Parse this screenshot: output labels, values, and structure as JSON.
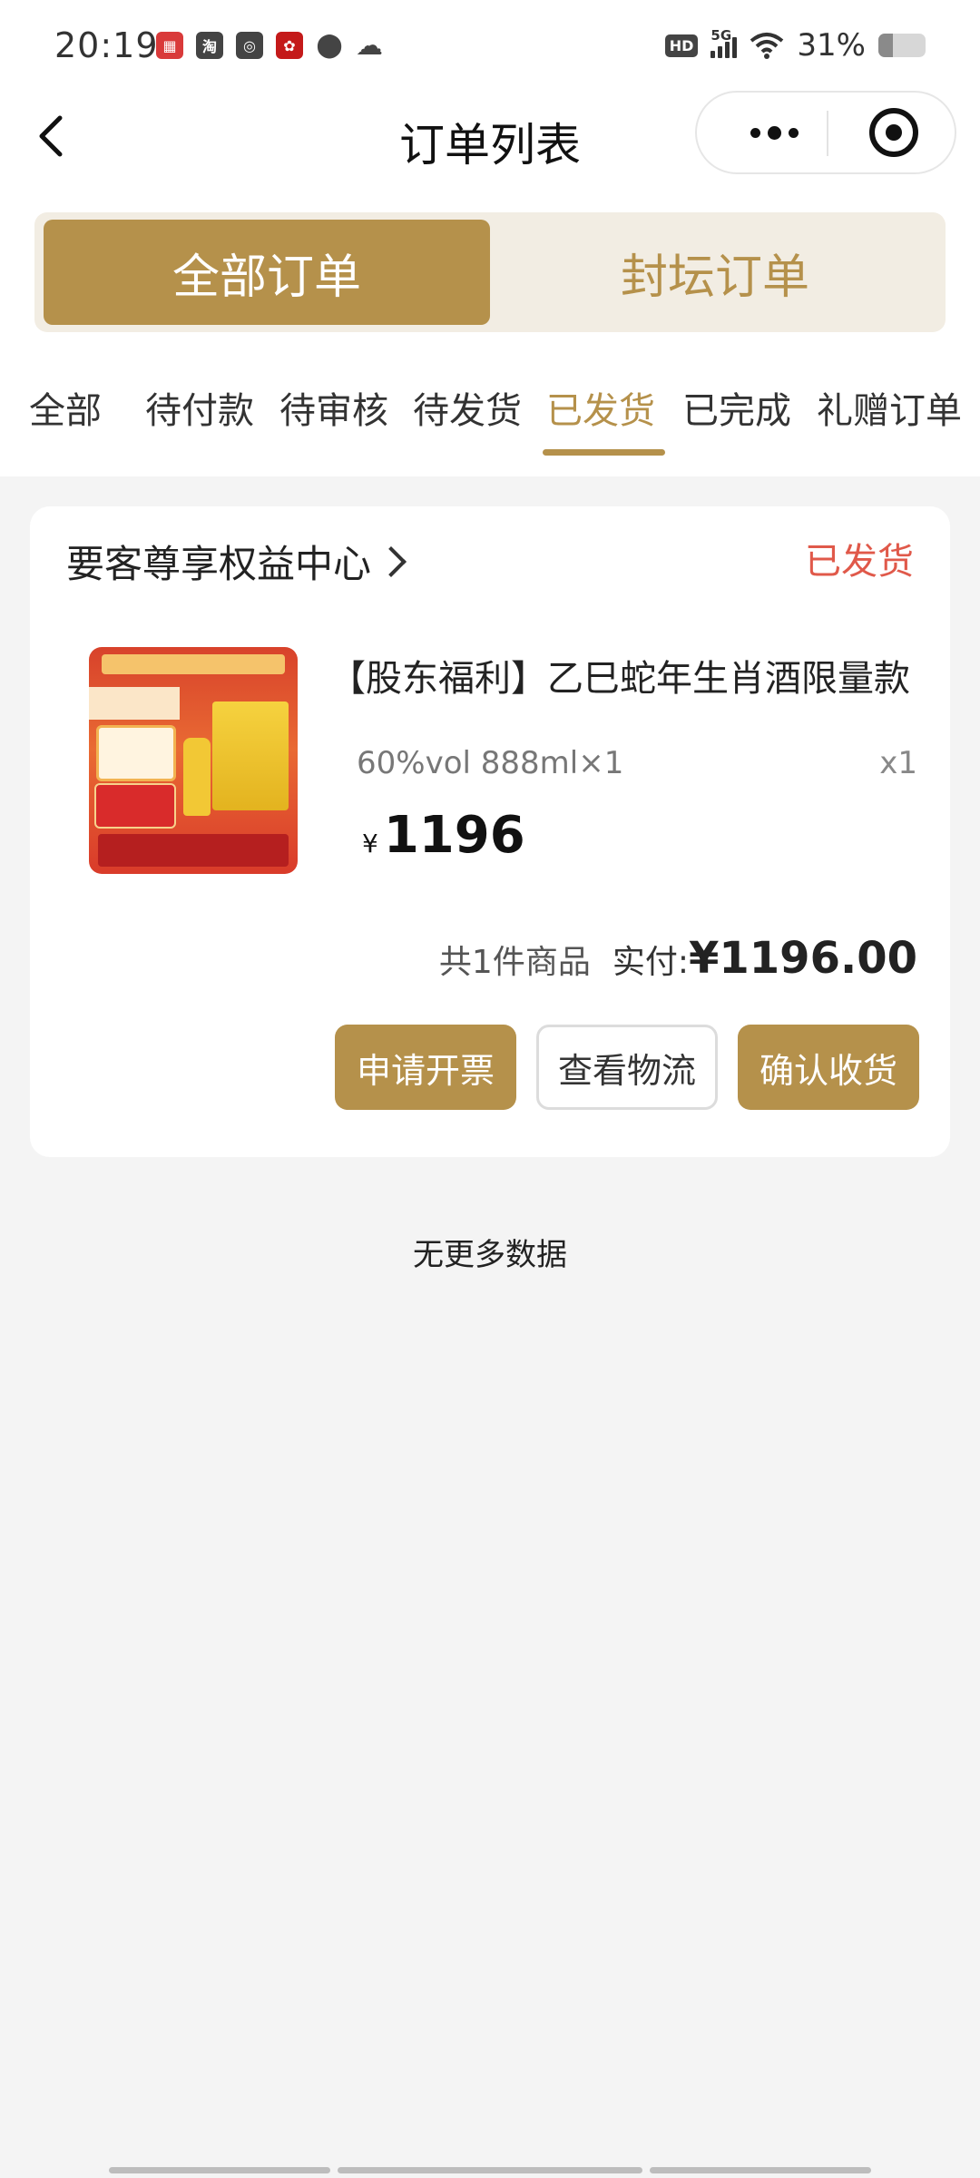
{
  "status_bar": {
    "time": "20:19",
    "network": "5G",
    "battery_percent": "31%",
    "battery_level": 0.31,
    "app_icons": [
      {
        "icon": "calendar-app-icon",
        "color": "#d93a3a"
      },
      {
        "icon": "taobao-app-icon",
        "color": "#444444"
      },
      {
        "icon": "search-app-icon",
        "color": "#444444"
      },
      {
        "icon": "red-app-icon",
        "color": "#c41a1a"
      },
      {
        "icon": "location-icon",
        "color": "#444444"
      },
      {
        "icon": "cloud-icon",
        "color": "#444444"
      }
    ]
  },
  "nav": {
    "title": "订单列表"
  },
  "segment": {
    "active_label": "全部订单",
    "inactive_label": "封坛订单"
  },
  "status_tabs": {
    "items": [
      {
        "label": "全部"
      },
      {
        "label": "待付款"
      },
      {
        "label": "待审核"
      },
      {
        "label": "待发货"
      },
      {
        "label": "已发货"
      },
      {
        "label": "已完成"
      },
      {
        "label": "礼赠订单"
      }
    ],
    "active_index": 4
  },
  "order": {
    "store_name": "要客尊享权益中心",
    "status": "已发货",
    "product": {
      "title": "【股东福利】乙巳蛇年生肖酒限量款",
      "spec": "60%vol 888ml×1",
      "quantity": "x1",
      "price_symbol": "¥",
      "price": "1196"
    },
    "summary": {
      "count_text": "共1件商品",
      "paid_label": "实付:",
      "paid_amount": "¥1196.00"
    },
    "actions": {
      "invoice": "申请开票",
      "logistics": "查看物流",
      "confirm": "确认收货"
    }
  },
  "footer": {
    "no_more": "无更多数据"
  },
  "colors": {
    "accent": "#b5914b",
    "status_red": "#e0594a",
    "background": "#f4f4f4"
  }
}
